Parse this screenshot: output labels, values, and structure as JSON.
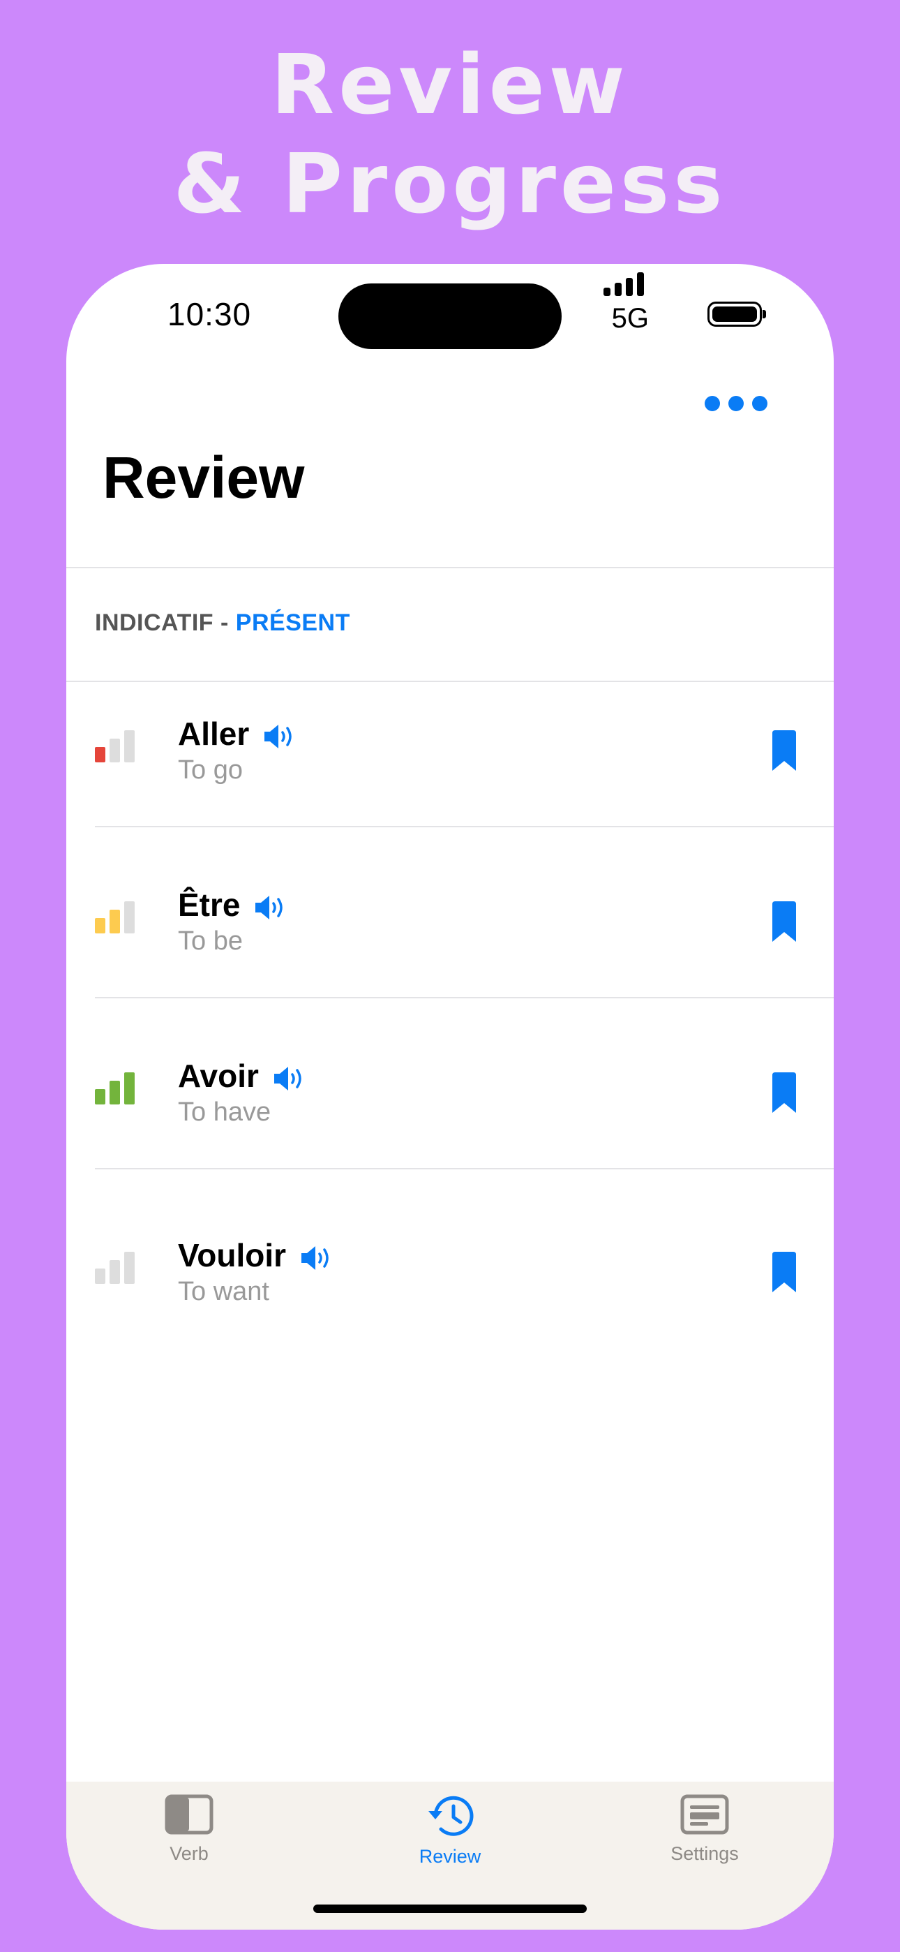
{
  "hero": {
    "line1": "Review",
    "line2": "& Progress"
  },
  "status_bar": {
    "time": "10:30",
    "network": "5G"
  },
  "header": {
    "title": "Review",
    "more_icon": "ellipsis-icon"
  },
  "section": {
    "prefix": "INDICATIF - ",
    "tense": "PRÉSENT"
  },
  "verbs": [
    {
      "verb": "Aller",
      "translation": "To go",
      "progress_level": 1,
      "level_color": "#E5453A"
    },
    {
      "verb": "Être",
      "translation": "To be",
      "progress_level": 2,
      "level_color": "#FDCB4F"
    },
    {
      "verb": "Avoir",
      "translation": "To have",
      "progress_level": 3,
      "level_color": "#73B43C"
    },
    {
      "verb": "Vouloir",
      "translation": "To want",
      "progress_level": 0,
      "level_color": "#DDDDDD"
    }
  ],
  "tabs": [
    {
      "label": "Verb",
      "icon": "sidebar-icon",
      "active": false
    },
    {
      "label": "Review",
      "icon": "history-clock-icon",
      "active": true
    },
    {
      "label": "Settings",
      "icon": "settings-card-icon",
      "active": false
    }
  ],
  "colors": {
    "background": "#CC88FB",
    "accent": "#0A7CF5",
    "tab_inactive": "#8E8A86",
    "bar_empty": "#DDDDDD"
  }
}
